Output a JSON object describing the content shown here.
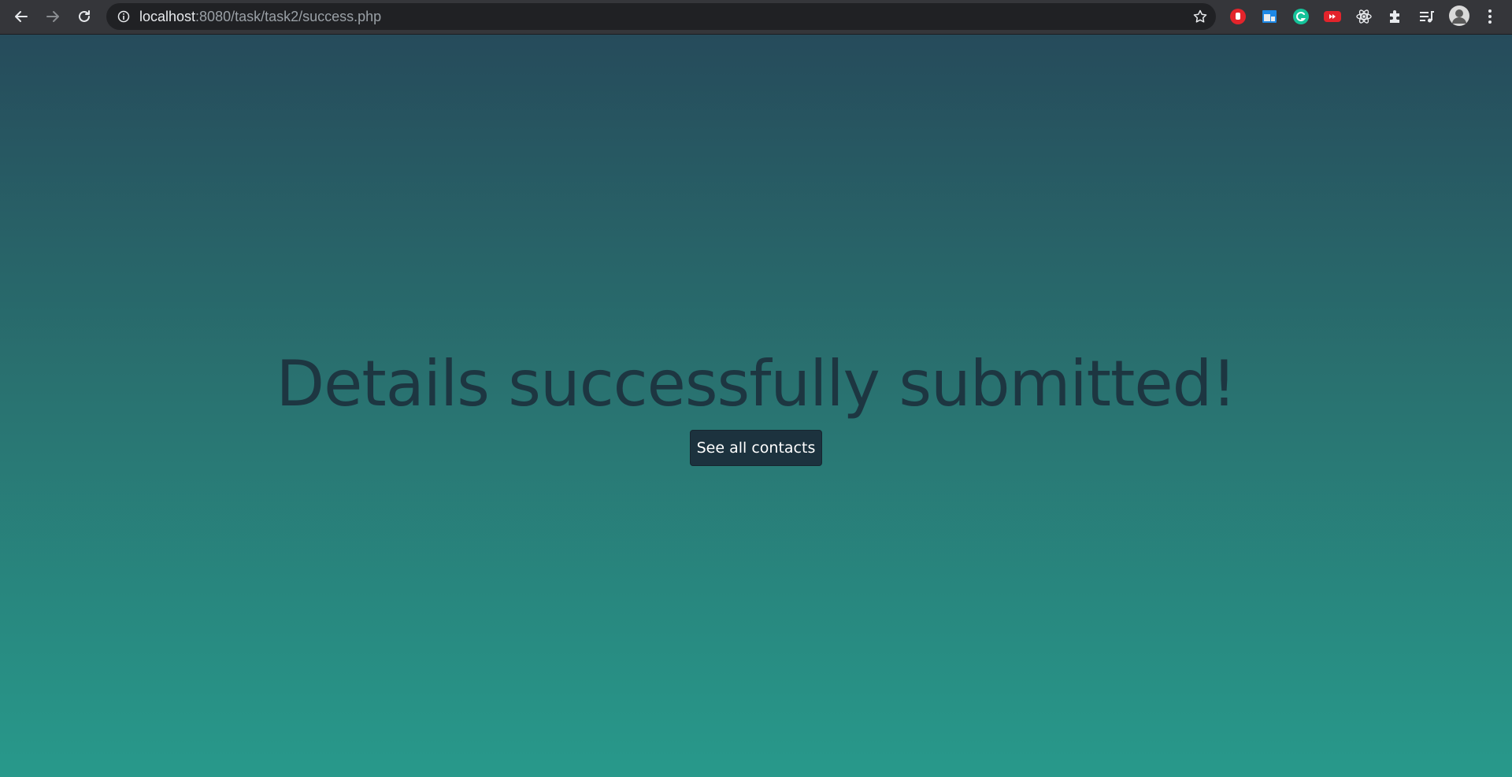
{
  "browser": {
    "url_host": "localhost",
    "url_rest": ":8080/task/task2/success.php",
    "extensions": [
      {
        "icon": "adblock-icon",
        "color": "#e3242b"
      },
      {
        "icon": "window-extension-icon",
        "color": "#1e88e5"
      },
      {
        "icon": "grammarly-icon",
        "color": "#15c39a"
      },
      {
        "icon": "youtube-extension-icon",
        "color": "#e3242b"
      },
      {
        "icon": "react-devtools-icon",
        "color": "#e8eaed"
      },
      {
        "icon": "puzzle-icon",
        "color": "#e8eaed"
      },
      {
        "icon": "media-control-icon",
        "color": "#e8eaed"
      }
    ]
  },
  "main": {
    "headline": "Details successfully submitted!",
    "button_label": "See all contacts"
  }
}
